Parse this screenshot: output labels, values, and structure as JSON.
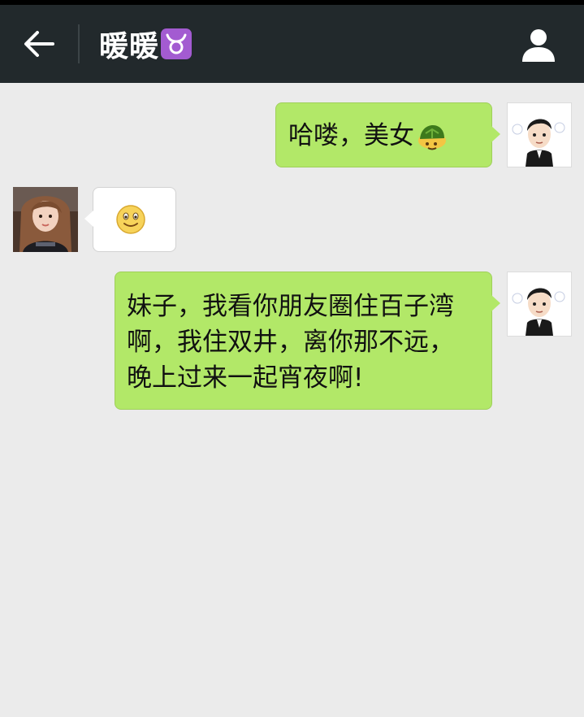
{
  "header": {
    "title": "暖暖",
    "title_emoji_icon": "taurus-zodiac-icon",
    "back_icon": "arrow-left-icon",
    "profile_icon": "user-profile-icon",
    "colors": {
      "bar": "#22292c",
      "title": "#ffffff",
      "badge": "#a35bd1"
    }
  },
  "chat": {
    "background": "#ebebeb",
    "outgoing_bubble_color": "#b2e868",
    "incoming_bubble_color": "#ffffff",
    "messages": [
      {
        "direction": "outgoing",
        "sender": "me",
        "text": "哈喽，美女",
        "trailing_icon": "turtle-emoji-icon"
      },
      {
        "direction": "incoming",
        "sender": "暖暖",
        "text": "",
        "trailing_icon": "smiley-emoji-icon"
      },
      {
        "direction": "outgoing",
        "sender": "me",
        "lines": [
          "妹子，我看你朋友圈住百子湾",
          "啊，我住双井，离你那不远，",
          "晚上过来一起宵夜啊!"
        ]
      }
    ]
  }
}
